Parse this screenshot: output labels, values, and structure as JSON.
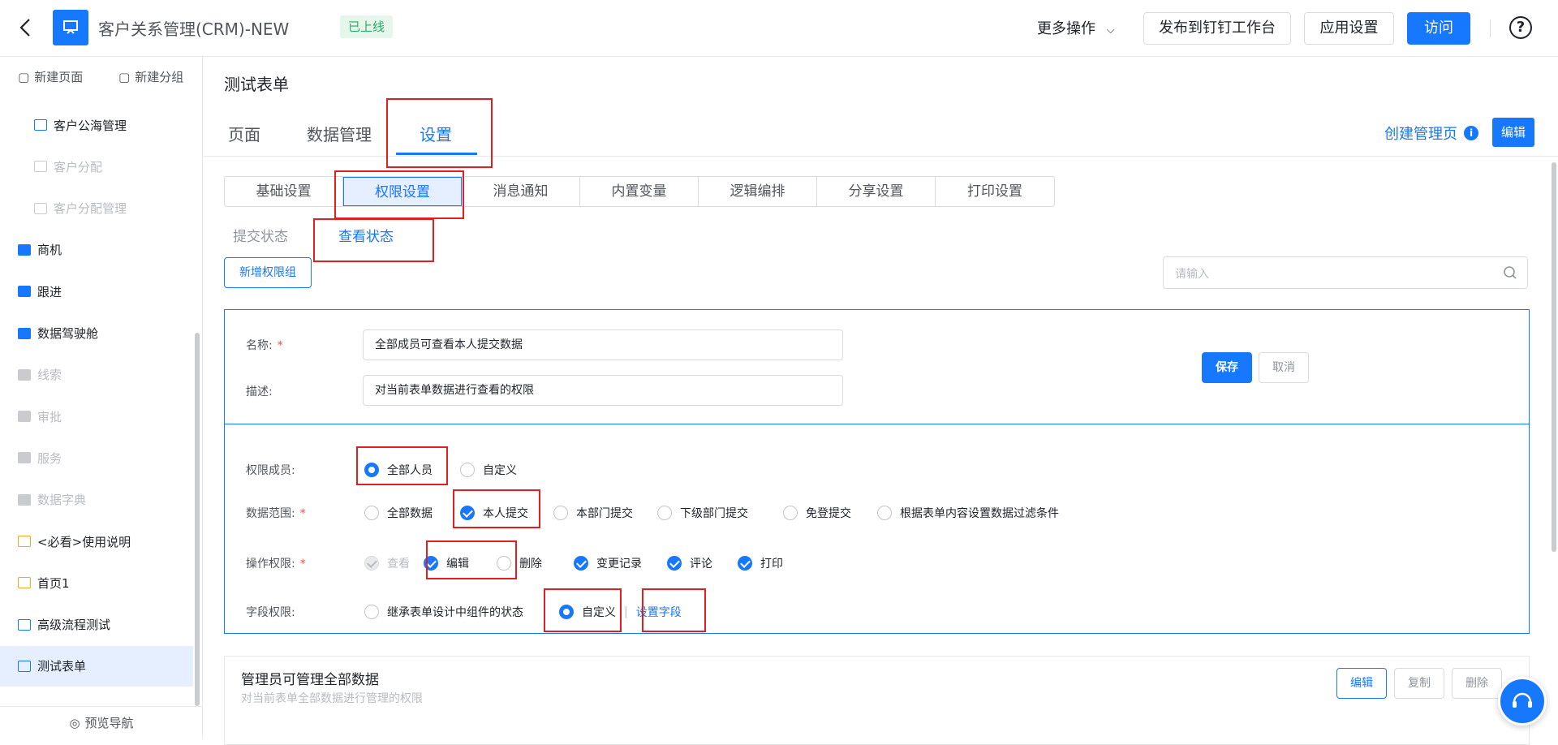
{
  "header": {
    "app_title": "客户关系管理(CRM)-NEW",
    "status_badge": "已上线",
    "more_actions": "更多操作",
    "publish_button": "发布到钉钉工作台",
    "app_settings_button": "应用设置",
    "visit_button": "访问"
  },
  "sidebar": {
    "new_page": "新建页面",
    "new_group": "新建分组",
    "items": [
      {
        "label": "客户公海管理",
        "icon": "form-icon",
        "state": "normal"
      },
      {
        "label": "客户分配",
        "icon": "doc-icon",
        "state": "dim"
      },
      {
        "label": "客户分配管理",
        "icon": "form-icon",
        "state": "dim"
      },
      {
        "label": "商机",
        "icon": "folder-icon",
        "state": "normal"
      },
      {
        "label": "跟进",
        "icon": "folder-icon",
        "state": "normal"
      },
      {
        "label": "数据驾驶舱",
        "icon": "folder-icon",
        "state": "normal"
      },
      {
        "label": "线索",
        "icon": "folder-icon",
        "state": "dim"
      },
      {
        "label": "审批",
        "icon": "folder-icon",
        "state": "dim"
      },
      {
        "label": "服务",
        "icon": "folder-icon",
        "state": "dim"
      },
      {
        "label": "数据字典",
        "icon": "folder-icon",
        "state": "dim"
      },
      {
        "label": "<必看>使用说明",
        "icon": "page-icon",
        "state": "normal"
      },
      {
        "label": "首页1",
        "icon": "page-icon",
        "state": "normal"
      },
      {
        "label": "高级流程测试",
        "icon": "flow-icon",
        "state": "normal"
      },
      {
        "label": "测试表单",
        "icon": "doc-icon",
        "state": "active"
      }
    ],
    "preview_nav": "预览导航"
  },
  "main": {
    "form_title": "测试表单",
    "tabs": [
      "页面",
      "数据管理",
      "设置"
    ],
    "active_tab": "设置",
    "create_admin_page": "创建管理页",
    "edit_button": "编辑",
    "settings_tabs": [
      "基础设置",
      "权限设置",
      "消息通知",
      "内置变量",
      "逻辑编排",
      "分享设置",
      "打印设置"
    ],
    "active_settings_tab": "权限设置",
    "sub_tabs": [
      "提交状态",
      "查看状态"
    ],
    "active_sub_tab": "查看状态",
    "add_group_button": "新增权限组",
    "search_placeholder": "请输入"
  },
  "permission_form": {
    "name_label": "名称:",
    "name_value": "全部成员可查看本人提交数据",
    "desc_label": "描述:",
    "desc_value": "对当前表单数据进行查看的权限",
    "save_button": "保存",
    "cancel_button": "取消",
    "members_label": "权限成员:",
    "members_options": [
      {
        "label": "全部人员",
        "selected": true
      },
      {
        "label": "自定义",
        "selected": false
      }
    ],
    "scope_label": "数据范围:",
    "scope_options": [
      {
        "label": "全部数据",
        "checked": false
      },
      {
        "label": "本人提交",
        "checked": true
      },
      {
        "label": "本部门提交",
        "checked": false
      },
      {
        "label": "下级部门提交",
        "checked": false
      },
      {
        "label": "免登提交",
        "checked": false
      },
      {
        "label": "根据表单内容设置数据过滤条件",
        "checked": false
      }
    ],
    "ops_label": "操作权限:",
    "ops_options": [
      {
        "label": "查看",
        "checked": true,
        "disabled": true
      },
      {
        "label": "编辑",
        "checked": true
      },
      {
        "label": "删除",
        "checked": false
      },
      {
        "label": "变更记录",
        "checked": true
      },
      {
        "label": "评论",
        "checked": true
      },
      {
        "label": "打印",
        "checked": true
      }
    ],
    "field_label": "字段权限:",
    "field_options": [
      {
        "label": "继承表单设计中组件的状态",
        "selected": false
      },
      {
        "label": "自定义",
        "selected": true
      }
    ],
    "set_fields_link": "设置字段"
  },
  "group2": {
    "title": "管理员可管理全部数据",
    "desc": "对当前表单全部数据进行管理的权限",
    "edit": "编辑",
    "copy": "复制",
    "delete": "删除"
  },
  "colors": {
    "accent": "#1677ff",
    "annotation": "#e02020",
    "badge_bg": "#e4f7ea"
  }
}
